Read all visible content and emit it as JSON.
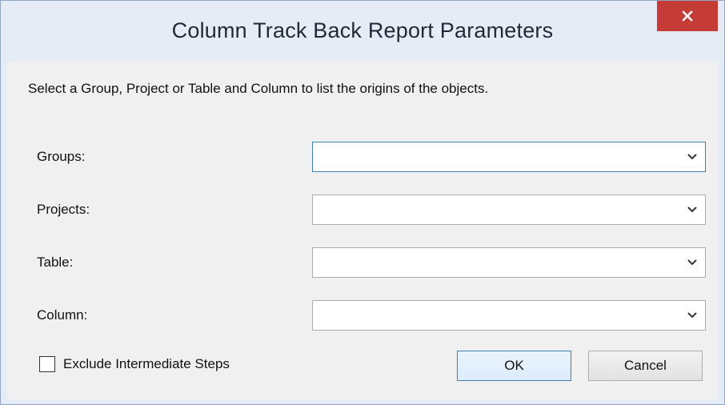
{
  "window": {
    "title": "Column Track Back Report Parameters",
    "close_label": "close"
  },
  "instruction": "Select a Group, Project or Table and Column to list the origins of the objects.",
  "fields": [
    {
      "label": "Groups:",
      "value": ""
    },
    {
      "label": "Projects:",
      "value": ""
    },
    {
      "label": "Table:",
      "value": ""
    },
    {
      "label": "Column:",
      "value": ""
    }
  ],
  "options": {
    "exclude_label": "Exclude Intermediate Steps",
    "exclude_checked": false
  },
  "buttons": {
    "ok_label": "OK",
    "cancel_label": "Cancel"
  },
  "colors": {
    "close_button": "#c43c35",
    "focus_border": "#3c7fb1",
    "client_background": "#f0f0f0"
  }
}
